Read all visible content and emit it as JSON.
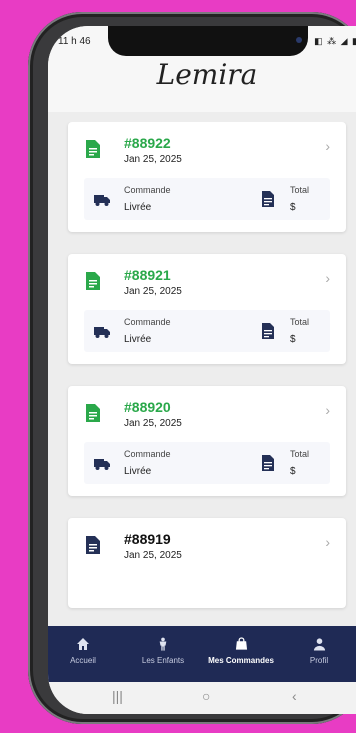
{
  "status": {
    "time": "11 h 46",
    "icons": "◧ ⁂ ◢ ▮"
  },
  "app": {
    "logo": "Lemira"
  },
  "orders": [
    {
      "id": "#88922",
      "date": "Jan 25, 2025",
      "commande_label": "Commande",
      "commande_status": "Livrée",
      "total_label": "Total",
      "total_value": "$",
      "accent": "green"
    },
    {
      "id": "#88921",
      "date": "Jan 25, 2025",
      "commande_label": "Commande",
      "commande_status": "Livrée",
      "total_label": "Total",
      "total_value": "$",
      "accent": "green"
    },
    {
      "id": "#88920",
      "date": "Jan 25, 2025",
      "commande_label": "Commande",
      "commande_status": "Livrée",
      "total_label": "Total",
      "total_value": "$",
      "accent": "green"
    },
    {
      "id": "#88919",
      "date": "Jan 25, 2025",
      "accent": "dark"
    }
  ],
  "nav": {
    "items": [
      {
        "label": "Accueil",
        "icon": "home-icon"
      },
      {
        "label": "Les Enfants",
        "icon": "child-icon"
      },
      {
        "label": "Mes Commandes",
        "icon": "shopping-bag-icon",
        "active": true
      },
      {
        "label": "Profil",
        "icon": "user-icon"
      }
    ]
  },
  "system_nav": {
    "recents": "|||",
    "home": "○",
    "back": "‹"
  },
  "colors": {
    "accent_green": "#2aa84a",
    "nav_bg": "#1f2a55",
    "icon_dark": "#243056",
    "background": "#e83cc4"
  }
}
